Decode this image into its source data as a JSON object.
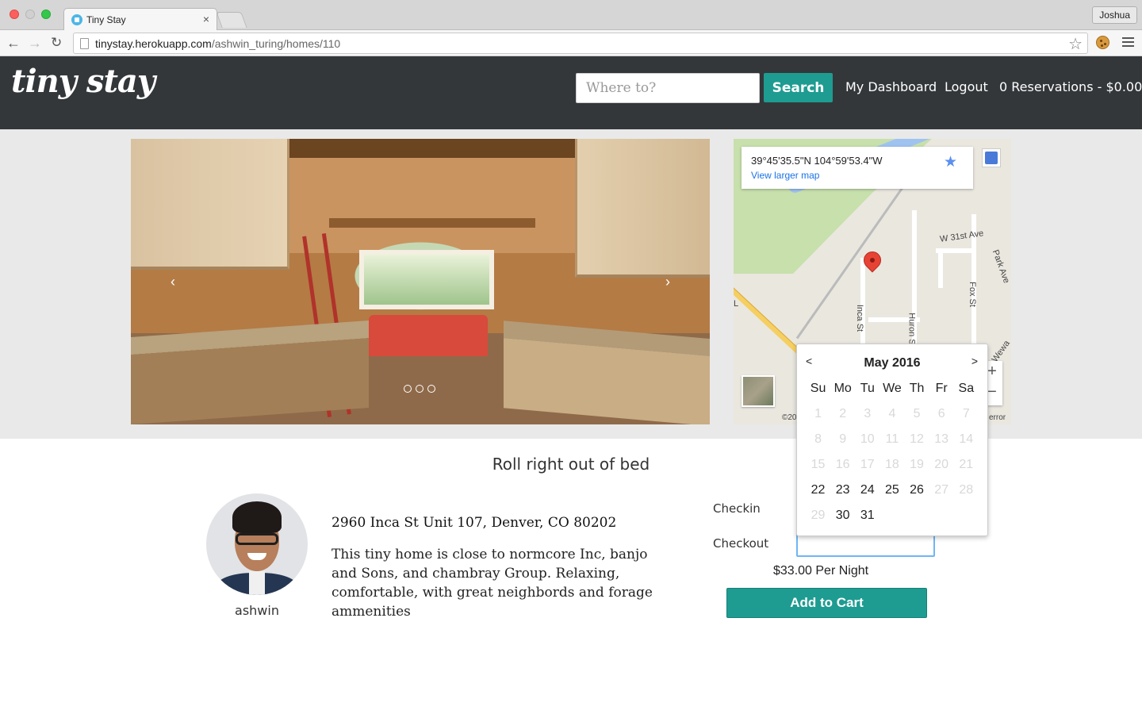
{
  "browser": {
    "tab_title": "Tiny Stay",
    "tab_close": "×",
    "profile_name": "Joshua",
    "url_host": "tinystay.herokuapp.com",
    "url_path": "/ashwin_turing/homes/110",
    "back_glyph": "←",
    "forward_glyph": "→",
    "reload_glyph": "↻",
    "star_glyph": "☆"
  },
  "header": {
    "logo": "tiny stay",
    "search_placeholder": "Where to?",
    "search_button": "Search",
    "nav": {
      "dashboard": "My Dashboard",
      "logout": "Logout",
      "cart": "0 Reservations - $0.00"
    }
  },
  "carousel": {
    "prev_glyph": "‹",
    "next_glyph": "›",
    "slide_count": 3,
    "active_slide": 1
  },
  "map": {
    "coordinates": "39°45'35.5\"N 104°59'53.4\"W",
    "view_larger": "View larger map",
    "save_glyph": "★",
    "labels": {
      "w31st": "W 31st Ave",
      "park_ave": "Park Ave",
      "inca_st": "Inca St",
      "huron_st": "Huron St",
      "fox_st": "Fox St",
      "wewa": "Wewa",
      "copyright": "©20",
      "error": "error",
      "l_fragment": "L"
    },
    "zoom_in": "+",
    "zoom_out": "−"
  },
  "listing": {
    "title": "Roll right out of bed",
    "host_name": "ashwin",
    "address": "2960 Inca St Unit 107, Denver, CO 80202",
    "description": "This tiny home is close to normcore Inc, banjo and Sons, and chambray Group. Relaxing, comfortable, with great neighbords and forage ammenities"
  },
  "booking": {
    "checkin_label": "Checkin",
    "checkout_label": "Checkout",
    "checkout_value": "",
    "price": "$33.00 Per Night",
    "add_to_cart": "Add to Cart"
  },
  "datepicker": {
    "prev": "<",
    "next": ">",
    "month": "May 2016",
    "weekdays": [
      "Su",
      "Mo",
      "Tu",
      "We",
      "Th",
      "Fr",
      "Sa"
    ],
    "weeks": [
      [
        {
          "d": "1",
          "off": true
        },
        {
          "d": "2",
          "off": true
        },
        {
          "d": "3",
          "off": true
        },
        {
          "d": "4",
          "off": true
        },
        {
          "d": "5",
          "off": true
        },
        {
          "d": "6",
          "off": true
        },
        {
          "d": "7",
          "off": true
        }
      ],
      [
        {
          "d": "8",
          "off": true
        },
        {
          "d": "9",
          "off": true
        },
        {
          "d": "10",
          "off": true
        },
        {
          "d": "11",
          "off": true
        },
        {
          "d": "12",
          "off": true
        },
        {
          "d": "13",
          "off": true
        },
        {
          "d": "14",
          "off": true
        }
      ],
      [
        {
          "d": "15",
          "off": true
        },
        {
          "d": "16",
          "off": true
        },
        {
          "d": "17",
          "off": true
        },
        {
          "d": "18",
          "off": true
        },
        {
          "d": "19",
          "off": true
        },
        {
          "d": "20",
          "off": true
        },
        {
          "d": "21",
          "off": true
        }
      ],
      [
        {
          "d": "22",
          "off": false
        },
        {
          "d": "23",
          "off": false
        },
        {
          "d": "24",
          "off": false
        },
        {
          "d": "25",
          "off": false
        },
        {
          "d": "26",
          "off": false
        },
        {
          "d": "27",
          "off": true
        },
        {
          "d": "28",
          "off": true
        }
      ],
      [
        {
          "d": "29",
          "off": true
        },
        {
          "d": "30",
          "off": false
        },
        {
          "d": "31",
          "off": false
        },
        {
          "d": "",
          "off": true
        },
        {
          "d": "",
          "off": true
        },
        {
          "d": "",
          "off": true
        },
        {
          "d": "",
          "off": true
        }
      ]
    ]
  },
  "colors": {
    "header_bg": "#33373a",
    "accent": "#1e9c91",
    "hero_bg": "#e9e9e9",
    "focus_ring": "#6fb6f5"
  }
}
